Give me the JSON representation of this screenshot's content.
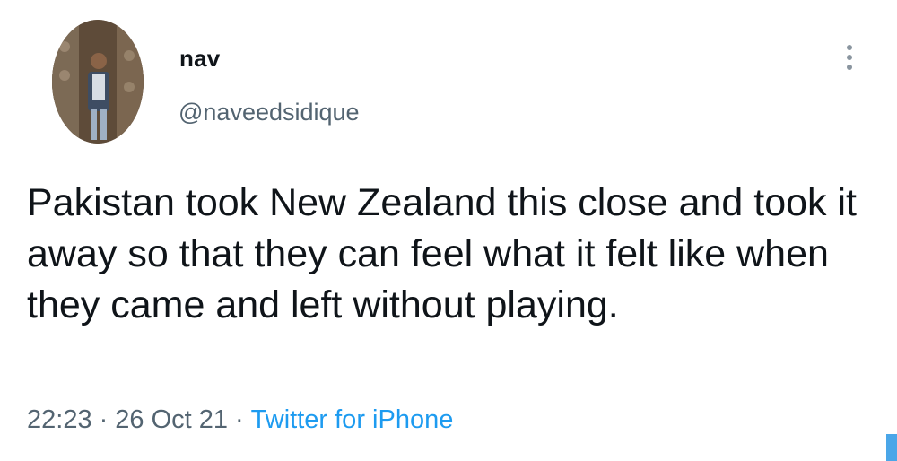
{
  "user": {
    "display_name": "nav",
    "handle": "@naveedsidique"
  },
  "tweet": {
    "text": "Pakistan took New Zealand this close and took it away so that they can feel what it felt like when they came and left without playing.",
    "time": "22:23",
    "date": "26 Oct 21",
    "separator": "·",
    "source": "Twitter for iPhone"
  },
  "icons": {
    "more": "more-vertical-icon"
  },
  "colors": {
    "text": "#0f1419",
    "secondary": "#536471",
    "link": "#1d9bf0"
  }
}
